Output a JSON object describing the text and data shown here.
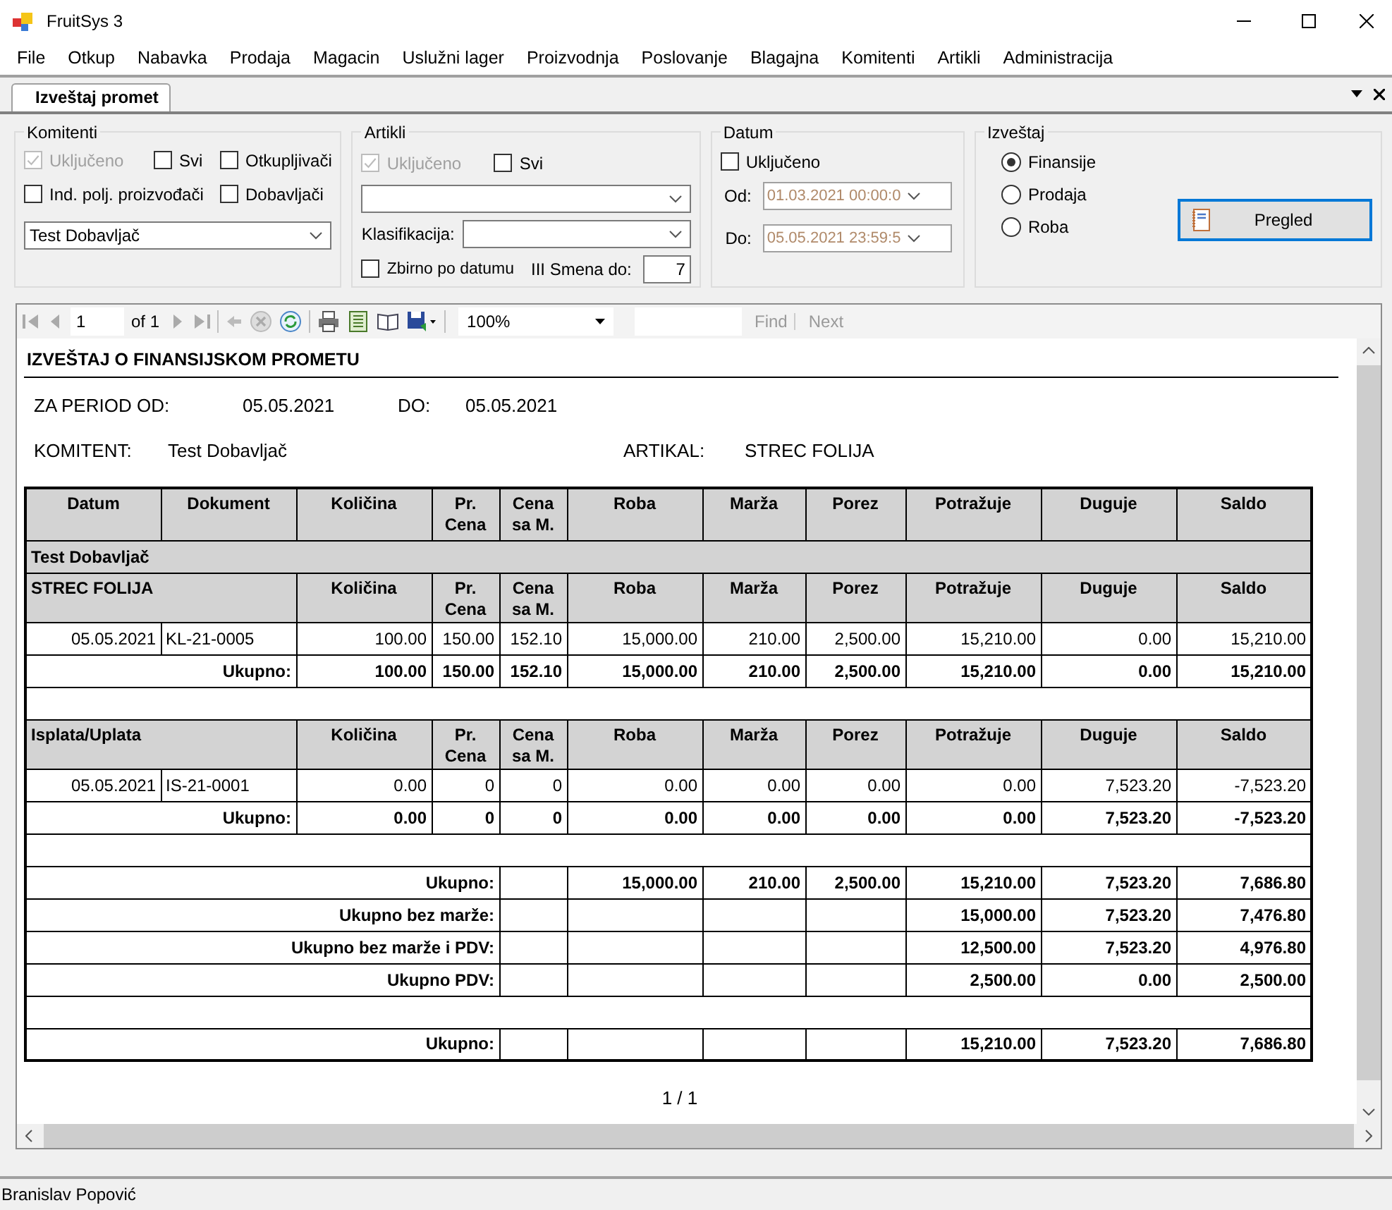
{
  "window": {
    "title": "FruitSys 3"
  },
  "menu": [
    "File",
    "Otkup",
    "Nabavka",
    "Prodaja",
    "Magacin",
    "Uslužni lager",
    "Proizvodnja",
    "Poslovanje",
    "Blagajna",
    "Komitenti",
    "Artikli",
    "Administracija"
  ],
  "tabs": [
    {
      "label": "Izveštaj promet",
      "selected": true
    }
  ],
  "filters": {
    "komitenti": {
      "title": "Komitenti",
      "options": [
        {
          "label": "Uključeno",
          "checked": true,
          "disabled": true
        },
        {
          "label": "Svi",
          "checked": false,
          "disabled": false
        },
        {
          "label": "Otkupljivači",
          "checked": false,
          "disabled": false
        },
        {
          "label": "Ind. polj. proizvođači",
          "checked": false,
          "disabled": false
        },
        {
          "label": "Dobavljači",
          "checked": false,
          "disabled": false
        }
      ],
      "combo": {
        "value": "Test Dobavljač"
      }
    },
    "artikli": {
      "title": "Artikli",
      "options": [
        {
          "label": "Uključeno",
          "checked": true,
          "disabled": true
        },
        {
          "label": "Svi",
          "checked": false,
          "disabled": false
        }
      ],
      "classification_label": "Klasifikacija:",
      "group_by_date": {
        "label": "Zbirno po datumu",
        "checked": false
      },
      "shift_label": "III Smena do:",
      "shift_value": "7"
    },
    "datum": {
      "title": "Datum",
      "enabled": {
        "label": "Uključeno",
        "checked": false
      },
      "from": {
        "label": "Od:",
        "value": "01.03.2021 00:00:0",
        "disabled": true
      },
      "to": {
        "label": "Do:",
        "value": "05.05.2021 23:59:5",
        "disabled": true
      }
    },
    "izvestaj": {
      "title": "Izveštaj",
      "options": [
        {
          "label": "Finansije",
          "selected": true
        },
        {
          "label": "Prodaja",
          "selected": false
        },
        {
          "label": "Roba",
          "selected": false
        }
      ],
      "button": "Pregled"
    }
  },
  "viewer": {
    "page": "1",
    "of": "of 1",
    "zoom": "100%",
    "find": "Find",
    "next": "Next"
  },
  "report": {
    "title": "IZVEŠTAJ O FINANSIJSKOM PROMETU",
    "period": {
      "from_label": "ZA PERIOD OD:",
      "from": "05.05.2021",
      "to_label": "DO:",
      "to": "05.05.2021"
    },
    "client": {
      "label": "KOMITENT:",
      "value": "Test Dobavljač",
      "article_label": "ARTIKAL:",
      "article": "STREC FOLIJA"
    },
    "rows": [
      {
        "kind": "header",
        "cells": [
          "Datum",
          "Dokument",
          "Količina",
          "Pr.\nCena",
          "Cena\nsa M.",
          "Roba",
          "Marža",
          "Porez",
          "Potražuje",
          "Duguje",
          "Saldo"
        ]
      },
      {
        "kind": "group",
        "label": "Test Dobavljač"
      },
      {
        "kind": "section",
        "label": "STREC FOLIJA",
        "cells": [
          "Količina",
          "Pr.\nCena",
          "Cena\nsa M.",
          "Roba",
          "Marža",
          "Porez",
          "Potražuje",
          "Duguje",
          "Saldo"
        ]
      },
      {
        "kind": "data",
        "cells": [
          "05.05.2021",
          "KL-21-0005",
          "100.00",
          "150.00",
          "152.10",
          "15,000.00",
          "210.00",
          "2,500.00",
          "15,210.00",
          "0.00",
          "15,210.00"
        ]
      },
      {
        "kind": "total",
        "label": "Ukupno:",
        "cells": [
          "100.00",
          "150.00",
          "152.10",
          "15,000.00",
          "210.00",
          "2,500.00",
          "15,210.00",
          "0.00",
          "15,210.00"
        ]
      },
      {
        "kind": "blank"
      },
      {
        "kind": "section",
        "label": "Isplata/Uplata",
        "cells": [
          "Količina",
          "Pr.\nCena",
          "Cena\nsa M.",
          "Roba",
          "Marža",
          "Porez",
          "Potražuje",
          "Duguje",
          "Saldo"
        ]
      },
      {
        "kind": "data",
        "cells": [
          "05.05.2021",
          "IS-21-0001",
          "0.00",
          "0",
          "0",
          "0.00",
          "0.00",
          "0.00",
          "0.00",
          "7,523.20",
          "-7,523.20"
        ]
      },
      {
        "kind": "total",
        "label": "Ukupno:",
        "cells": [
          "0.00",
          "0",
          "0",
          "0.00",
          "0.00",
          "0.00",
          "0.00",
          "7,523.20",
          "-7,523.20"
        ]
      },
      {
        "kind": "blank"
      },
      {
        "kind": "summary",
        "label": "Ukupno:",
        "cells": [
          null,
          "15,000.00",
          "210.00",
          "2,500.00",
          "15,210.00",
          "7,523.20",
          "7,686.80"
        ]
      },
      {
        "kind": "summary",
        "label": "Ukupno bez marže:",
        "cells": [
          null,
          null,
          null,
          null,
          "15,000.00",
          "7,523.20",
          "7,476.80"
        ]
      },
      {
        "kind": "summary",
        "label": "Ukupno bez marže i PDV:",
        "cells": [
          null,
          null,
          null,
          null,
          "12,500.00",
          "7,523.20",
          "4,976.80"
        ]
      },
      {
        "kind": "summary",
        "label": "Ukupno PDV:",
        "cells": [
          null,
          null,
          null,
          null,
          "2,500.00",
          "0.00",
          "2,500.00"
        ]
      },
      {
        "kind": "blank"
      },
      {
        "kind": "summary",
        "label": "Ukupno:",
        "cells": [
          null,
          null,
          null,
          null,
          "15,210.00",
          "7,523.20",
          "7,686.80"
        ]
      }
    ],
    "page_number": "1 / 1"
  },
  "status_bar": {
    "user": "Branislav Popović"
  }
}
